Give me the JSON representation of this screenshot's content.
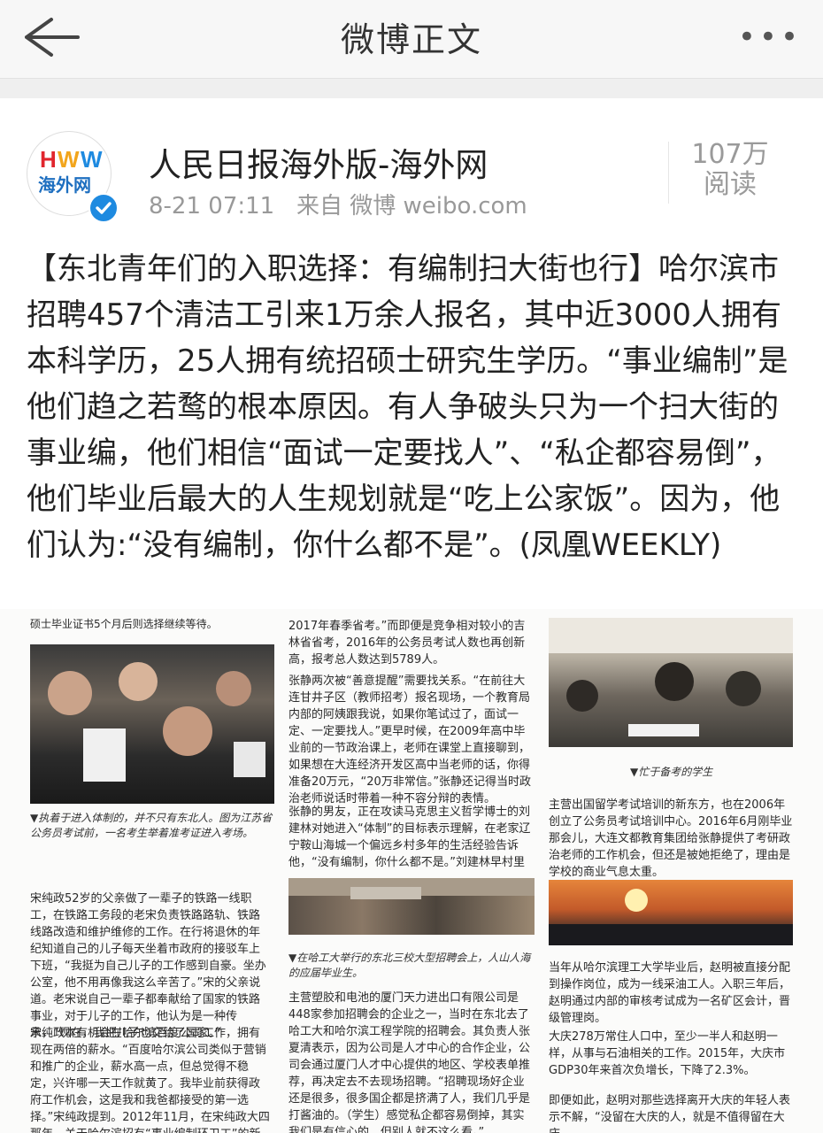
{
  "nav": {
    "title": "微博正文",
    "more": "•••"
  },
  "post": {
    "author": "人民日报海外版-海外网",
    "avatar_text": "海外网",
    "time": "8-21 07:11",
    "source": "来自 微博 weibo.com",
    "reads_count": "107万",
    "reads_label": "阅读",
    "text": "【东北青年们的入职选择：有编制扫大街也行】哈尔滨市招聘457个清洁工引来1万余人报名，其中近3000人拥有本科学历，25人拥有统招硕士研究生学历。“事业编制”是他们趋之若鹜的根本原因。有人争破头只为一个扫大街的事业编，他们相信“面试一定要找人”、“私企都容易倒”，他们毕业后最大的人生规划就是“吃上公家饭”。因为，他们认为:“没有编制，你什么都不是”。(凤凰WEEKLY)"
  },
  "article": {
    "top_fragment": "硕士毕业证书5个月后则选择继续等待。",
    "caption1": "▼执着于进入体制的，并不只有东北人。图为江苏省公务员考试前，一名考生举着准考证进入考场。",
    "col1_p1": "宋纯政52岁的父亲做了一辈子的铁路一线职工，在铁路工务段的老宋负责铁路路轨、铁路线路改造和维护维修的工作。在行将退休的年纪知道自己的儿子每天坐着市政府的接驳车上下班，“我挺为自己儿子的工作感到自豪。坐办公室，他不用再像我这么辛苦了。”宋的父亲说道。老宋说自己一辈子都奉献给了国家的铁路事业，对于儿子的工作，他认为是一种传承，“现在，我把儿子也交给了国家。”",
    "col1_p2": "宋纯政本有机会在哈尔滨百度公司工作，拥有现在两倍的薪水。“百度哈尔滨公司类似于营销和推广的企业，薪水高一点，但总觉得不稳定，兴许哪一天工作就黄了。我毕业前获得政府工作机会，这是我和我爸都接受的第一选择。”宋纯政提到。2012年11月，在宋纯政大四那年，关于哈尔滨招有“事业编制环卫工”的新闻热炒网络。",
    "col2_p1": "2017年春季省考。”而即便是竞争相对较小的吉林省省考，2016年的公务员考试人数也再创新高，报考总人数达到5789人。",
    "col2_p2": "张静两次被“善意提醒”需要找关系。“在前往大连甘井子区（教师招考）报名现场，一个教育局内部的阿姨跟我说，如果你笔试过了，面试一定、一定要找人。”更早时候，在2009年高中毕业前的一节政治课上，老师在课堂上直接聊到，如果想在大连经济开发区高中当老师的话，你得准备20万元，“20万非常信。”张静还记得当时政治老师说话时带着一种不容分辩的表情。",
    "col2_p3": "张静的男友，正在攻读马克思主义哲学博士的刘建林对她进入“体制”的目标表示理解，在老家辽宁鞍山海城一个偏远乡村多年的生活经验告诉他，“没有编制，你什么都不是。”刘建林早村里走出去的第",
    "caption2": "▼在哈工大举行的东北三校大型招聘会上，人山人海的应届毕业生。",
    "col2_p4": "主营塑胶和电池的厦门天力进出口有限公司是448家参加招聘会的企业之一，当时在东北去了哈工大和哈尔滨工程学院的招聘会。其负责人张夏清表示，因为公司是人才中心的合作企业，公司会通过厦门人才中心提供的地区、学校表单推荐，再决定去不去现场招聘。“招聘现场好企业还是很多，很多国企都是挤满了人，我们几乎是打酱油的。（学生）感觉私企都容易倒掉，其实我们是有信心的，但别人就不这么看。”",
    "caption3": "▼忙于备考的学生",
    "col3_p1": "主营出国留学考试培训的新东方，也在2006年创立了公务员考试培训中心。2016年6月刚毕业那会儿，大连文都教育集团给张静提供了考研政治老师的工作机会，但还是被她拒绝了，理由是学校的商业气息太重。",
    "col3_p2": "当年从哈尔滨理工大学毕业后，赵明被直接分配到操作岗位，成为一线采油工人。入职三年后，赵明通过内部的审核考试成为一名矿区会计，晋级管理岗。",
    "col3_p3": "大庆278万常住人口中，至少一半人和赵明一样，从事与石油相关的工作。2015年，大庆市GDP30年来首次负增长，下降了2.3%。",
    "col3_p4": "即便如此，赵明对那些选择离开大庆的年轻人表示不解，“没留在大庆的人，就是不值得留在大庆"
  },
  "colors": {
    "verified": "#1e8ae0",
    "nav_bg": "#f7f7f7",
    "meta": "#999999"
  },
  "icons": [
    "back-arrow-icon",
    "more-icon",
    "verified-icon"
  ]
}
